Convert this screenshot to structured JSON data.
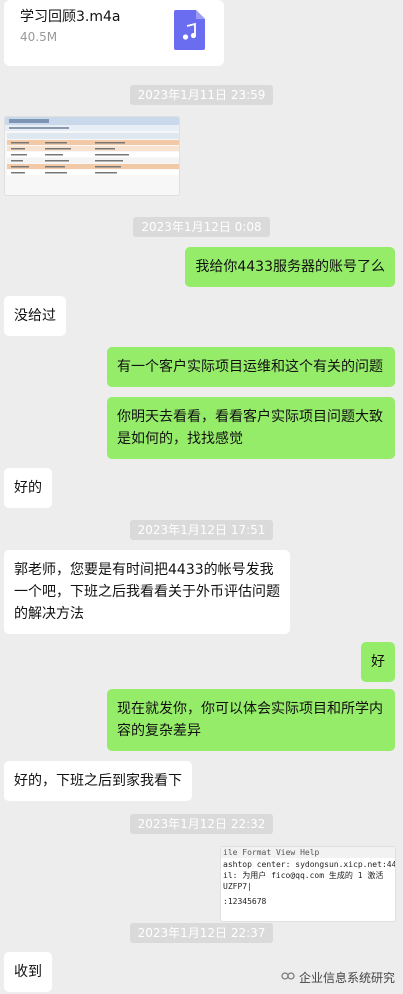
{
  "file": {
    "name": "学习回顾3.m4a",
    "size": "40.5M",
    "icon": "music-file-icon"
  },
  "timestamps": {
    "t1": "2023年1月11日 23:59",
    "t2": "2023年1月12日 0:08",
    "t3": "2023年1月12日 17:51",
    "t4": "2023年1月12日 22:32",
    "t5": "2023年1月12日 22:37"
  },
  "messages": {
    "m1": "我给你4433服务器的账号了么",
    "m2": "没给过",
    "m3": "有一个客户实际项目运维和这个有关的问题",
    "m4": "你明天去看看，看看客户实际项目问题大致是如何的，找找感觉",
    "m5": "好的",
    "m6": "郭老师，您要是有时间把4433的帐号发我一个吧，下班之后我看看关于外币评估问题的解决方法",
    "m7": "好",
    "m8": "现在就发你，你可以体会实际项目和所学内容的复杂差异",
    "m9": "好的，下班之后到家我看下",
    "m10": "收到"
  },
  "terminal": {
    "line0": "ile  Format  View  Help",
    "line1": "ashtop center: sydongsun.xicp.net:44",
    "line2": "il: 为用户 fico@qq.com 生成的 1 激活",
    "line3": "UZFP7|",
    "line4": ":12345678"
  },
  "watermark": {
    "text": "企业信息系统研究",
    "icon": "wechat-channel-icon"
  },
  "colors": {
    "sent_bubble": "#95ec69",
    "received_bubble": "#ffffff",
    "background": "#ededed"
  }
}
